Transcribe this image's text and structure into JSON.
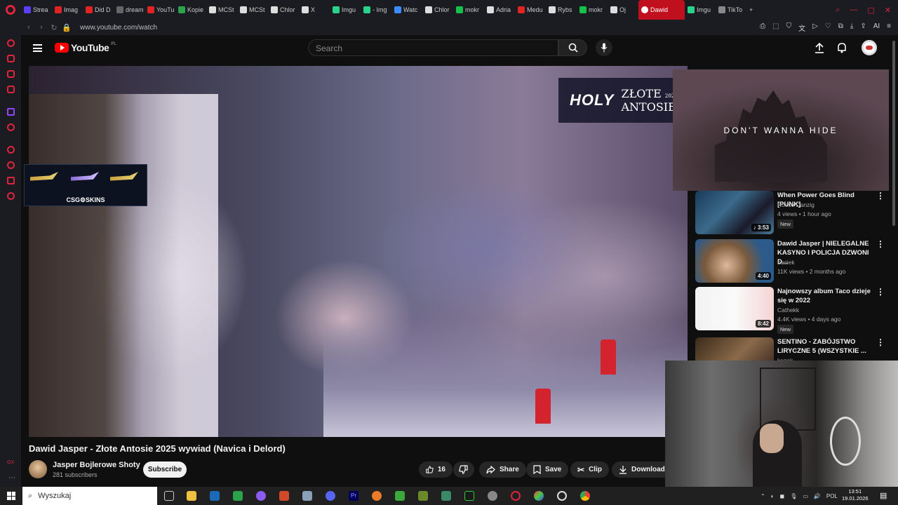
{
  "browser": {
    "tabs": [
      {
        "label": "Strea",
        "color": "#5b3fff"
      },
      {
        "label": "Imag",
        "color": "#e02424"
      },
      {
        "label": "Did D",
        "color": "#e02424"
      },
      {
        "label": "dream",
        "color": "#666666"
      },
      {
        "label": "YouTu",
        "color": "#e02424"
      },
      {
        "label": "Kopie",
        "color": "#2aa34a"
      },
      {
        "label": "MCSt",
        "color": "#dddddd"
      },
      {
        "label": "MCSt",
        "color": "#dddddd"
      },
      {
        "label": "Chlor",
        "color": "#dddddd"
      },
      {
        "label": "X",
        "color": "#dddddd"
      },
      {
        "label": "Imgu",
        "color": "#2ad38a"
      },
      {
        "label": "- Img",
        "color": "#2ad38a"
      },
      {
        "label": "Watc",
        "color": "#3b8cff"
      },
      {
        "label": "Chlor",
        "color": "#dddddd"
      },
      {
        "label": "mokr",
        "color": "#15c14a"
      },
      {
        "label": "Adria",
        "color": "#dddddd"
      },
      {
        "label": "Medu",
        "color": "#e02424"
      },
      {
        "label": "Rybs",
        "color": "#dddddd"
      },
      {
        "label": "mokr",
        "color": "#15c14a"
      },
      {
        "label": "Oj",
        "color": "#dddddd"
      }
    ],
    "active_tab": "Dawid",
    "after_tabs": [
      {
        "label": "Imgu",
        "color": "#2ad38a"
      },
      {
        "label": "TikTo",
        "color": "#888888"
      }
    ],
    "url": "www.youtube.com/watch",
    "ai_label": "AI"
  },
  "youtube": {
    "logo_word": "YouTube",
    "country": "PL",
    "search_placeholder": "Search"
  },
  "video": {
    "overlay_brand": "HOLY",
    "overlay_title_1": "ZŁOTE",
    "overlay_year": "2025",
    "overlay_title_2": "ANTOSIE",
    "csgo_label": "CSG⚙SKINS",
    "title": "Dawid Jasper - Złote Antosie 2025 wywiad (Navica i Delord)",
    "channel": "Jasper Bojlerowe Shoty",
    "subscribers": "281 subscribers",
    "subscribe_label": "Subscribe",
    "likes": "16",
    "share_label": "Share",
    "save_label": "Save",
    "clip_label": "Clip",
    "download_label": "Download"
  },
  "miniplayer": {
    "text": "DON'T WANNA HIDE"
  },
  "recommendations": [
    {
      "title": "When Power Goes Blind [PUNK]",
      "channel": "Rocco Danzig",
      "meta": "4 views • 1 hour ago",
      "badge": "New",
      "duration": "♪ 3:53"
    },
    {
      "title": "Dawid Jasper | NIELEGALNE KASYNO I POLICJA DZWONI D...",
      "channel": "baciek",
      "meta": "11K views • 2 months ago",
      "badge": "",
      "duration": "4:40"
    },
    {
      "title": "Najnowszy album Taco dzieje się w 2022",
      "channel": "Cathekk",
      "meta": "4.4K views • 4 days ago",
      "badge": "New",
      "duration": "8:42"
    },
    {
      "title": "SENTINO - ZABÓJSTWO LIRYCZNE 5 (WSZYSTKIE ...",
      "channel": "kozak",
      "meta": "",
      "badge": "",
      "duration": ""
    }
  ],
  "taskbar": {
    "search_label": "Wyszukaj",
    "language": "POL",
    "time": "13:51",
    "date": "19.01.2026"
  }
}
